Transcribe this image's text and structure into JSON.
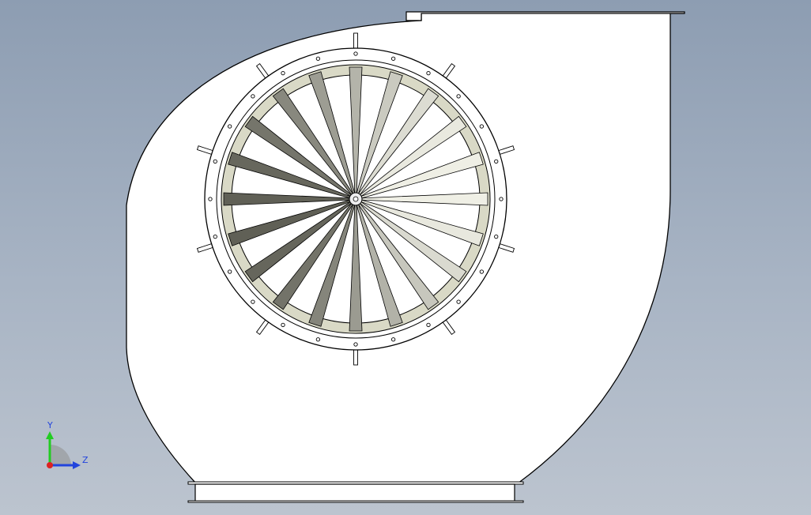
{
  "viewport": {
    "background_top": "#8d9db2",
    "background_bottom": "#bcc4cf"
  },
  "model": {
    "housing_fill": "#ffffff",
    "outline_color": "#000000",
    "rim_color": "#d8d8c4",
    "blade_count": 20,
    "bolt_count": 24,
    "bracket_count": 10
  },
  "triad": {
    "y_label": "Y",
    "z_label": "Z",
    "y_color": "#22cc22",
    "z_color": "#2244dd",
    "origin_color": "#dd2222"
  }
}
